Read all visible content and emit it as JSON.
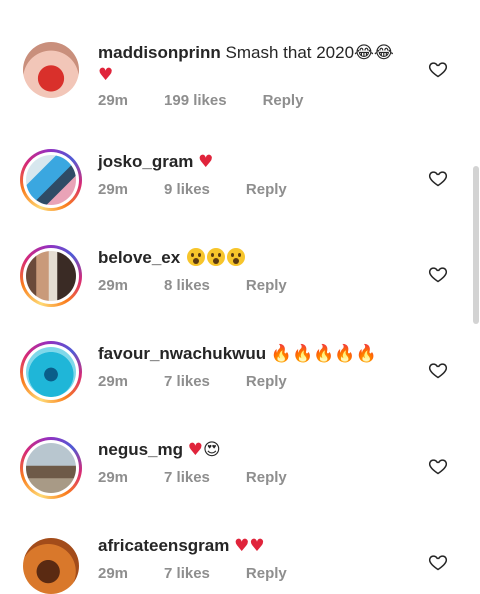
{
  "comments": [
    {
      "username": "maddisonprinn",
      "text": "Smash that 2020",
      "emoji": "😂😂❤️",
      "time": "29m",
      "likes": "199 likes",
      "reply": "Reply",
      "avatar_colors": [
        "#f2c6b8",
        "#d9302b"
      ]
    },
    {
      "username": "josko_gram",
      "text": "",
      "emoji": "❤️",
      "time": "29m",
      "likes": "9 likes",
      "reply": "Reply",
      "avatar_colors": [
        "#3aa7e0",
        "#d7e7ee"
      ]
    },
    {
      "username": "belove_ex",
      "text": "",
      "emoji": "😮😮😮",
      "time": "29m",
      "likes": "8 likes",
      "reply": "Reply",
      "avatar_colors": [
        "#c99a7a",
        "#6b4a3a"
      ]
    },
    {
      "username": "favour_nwachukwuu",
      "text": "",
      "emoji": "🔥🔥🔥🔥🔥",
      "time": "29m",
      "likes": "7 likes",
      "reply": "Reply",
      "avatar_colors": [
        "#1fb6d8",
        "#0a5e8a"
      ]
    },
    {
      "username": "negus_mg",
      "text": "",
      "emoji": "❤️😍",
      "time": "29m",
      "likes": "7 likes",
      "reply": "Reply",
      "avatar_colors": [
        "#b8c6cf",
        "#6e5a48"
      ]
    },
    {
      "username": "africateensgram",
      "text": "",
      "emoji": "❤️❤️",
      "time": "29m",
      "likes": "7 likes",
      "reply": "Reply",
      "avatar_colors": [
        "#d9782b",
        "#5a2a12"
      ]
    }
  ]
}
